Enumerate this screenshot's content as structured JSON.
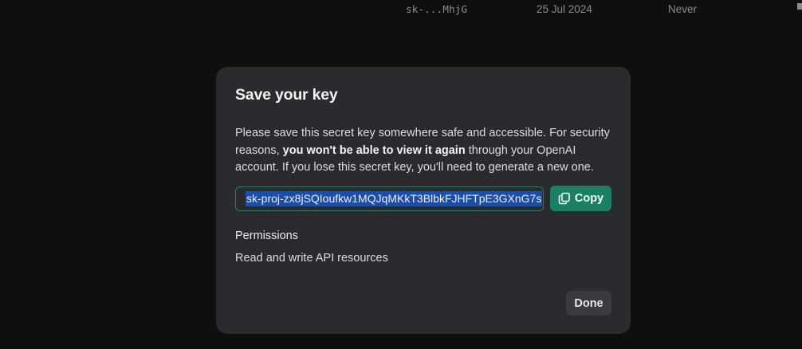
{
  "background_table": {
    "row": {
      "key": "sk-...MhjG",
      "created": "25 Jul 2024",
      "last_used": "Never"
    }
  },
  "modal": {
    "title": "Save your key",
    "description": {
      "part1": "Please save this secret key somewhere safe and accessible. For security reasons, ",
      "bold": "you won't be able to view it again",
      "part2": " through your OpenAI account. If you lose this secret key, you'll need to generate a new one."
    },
    "secret_key_value": "sk-proj-zx8jSQIoufkw1MQJqMKkT3BlbkFJHFTpE3GXnG7s",
    "copy_label": "Copy",
    "permissions_label": "Permissions",
    "permissions_value": "Read and write API resources",
    "done_label": "Done"
  },
  "colors": {
    "page_background": "#0f0f10",
    "modal_background": "#2a2b2e",
    "accent_green": "#1a7f64",
    "selection_blue": "#1d4ea3"
  },
  "icons": {
    "copy": "copy-icon"
  }
}
